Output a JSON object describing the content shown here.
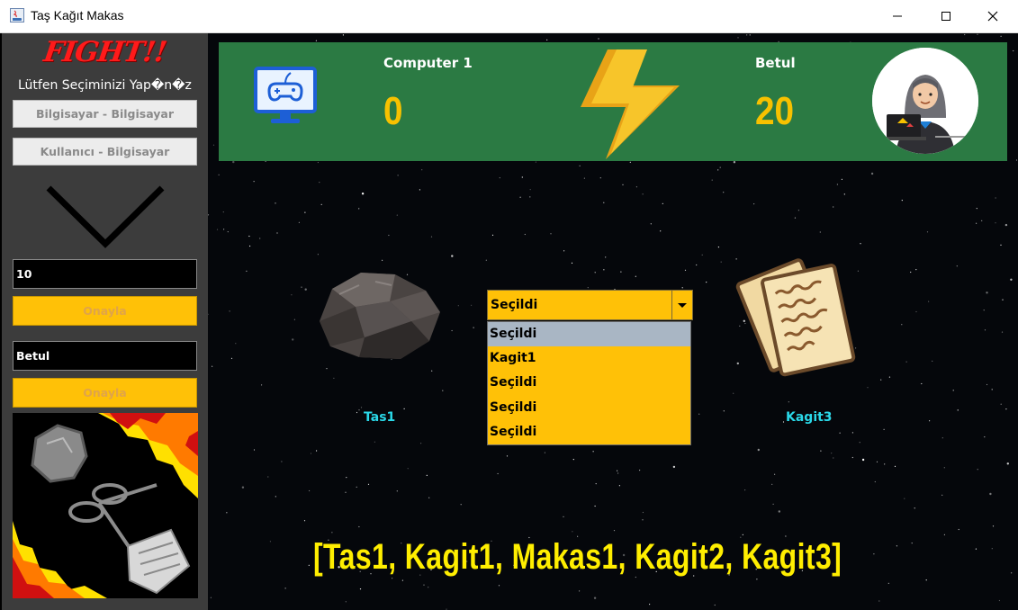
{
  "window": {
    "title": "Taş Kağıt Makas",
    "controls": [
      "minimize",
      "maximize",
      "close"
    ]
  },
  "sidebar": {
    "fight_label": "FIGHT!!",
    "prompt": "Lütfen Seçiminizi Yap�n�z",
    "mode_buttons": [
      "Bilgisayar - Bilgisayar",
      "Kullanıcı - Bilgisayar"
    ],
    "rounds_input": {
      "value": "10"
    },
    "confirm_label_1": "Onayla",
    "name_input": {
      "value": "Betul"
    },
    "confirm_label_2": "Onayla"
  },
  "scoreboard": {
    "left_player": {
      "name": "Computer 1",
      "score": "0",
      "icon": "gamepad-monitor-icon"
    },
    "right_player": {
      "name": "Betul",
      "score": "20",
      "icon": "hacker-avatar"
    },
    "center_icon": "lightning-bolt-icon"
  },
  "arena": {
    "left_card": {
      "label": "Tas1",
      "icon": "rock-icon"
    },
    "right_card": {
      "label": "Kagit3",
      "icon": "paper-icon"
    },
    "combo": {
      "selected": "Seçildi",
      "options": [
        "Seçildi",
        "Kagit1",
        "Seçildi",
        "Seçildi",
        "Seçildi"
      ],
      "highlighted_index": 0
    },
    "deck_text": "[Tas1, Kagit1, Makas1, Kagit2, Kagit3]"
  },
  "colors": {
    "accent_yellow": "#ffc107",
    "scoreboard_green": "#2b7a43",
    "score_color": "#f7c100",
    "fight_red": "#ff1a1a",
    "card_label_cyan": "#2ad8e8",
    "deck_yellow": "#ffee00"
  }
}
